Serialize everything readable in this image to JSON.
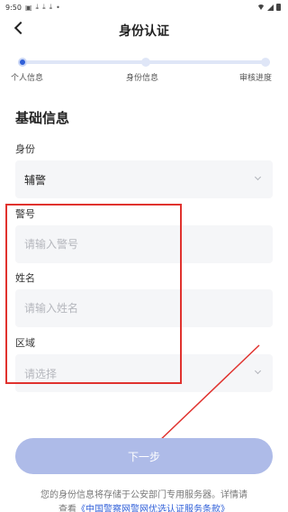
{
  "status_bar": {
    "time": "9:50",
    "icons": [
      "image-icon",
      "download-icon",
      "download-icon",
      "download-icon",
      "dot-icon"
    ],
    "right_icons": [
      "wifi-icon",
      "signal-icon",
      "battery-icon"
    ]
  },
  "nav": {
    "title": "身份认证",
    "back_icon": "chevron-left-icon"
  },
  "progress": {
    "steps": [
      {
        "label": "个人信息",
        "active": true
      },
      {
        "label": "身份信息",
        "active": false
      },
      {
        "label": "审核进度",
        "active": false
      }
    ],
    "colors": {
      "active": "#2f5fd8",
      "inactive": "#dfe6f7"
    }
  },
  "section_title": "基础信息",
  "form": {
    "identity": {
      "label": "身份",
      "value": "辅警"
    },
    "badge_number": {
      "label": "警号",
      "placeholder": "请输入警号"
    },
    "name": {
      "label": "姓名",
      "placeholder": "请输入姓名"
    },
    "region": {
      "label": "区域",
      "placeholder": "请选择"
    }
  },
  "next_button": {
    "label": "下一步",
    "color": "#aebbe8"
  },
  "footer": {
    "line1": "您的身份信息将存储于公安部门专用服务器。详情请",
    "line2_prefix": "查看",
    "line2_link": "《中国警察网警网优选认证服务条款》"
  },
  "annotation": {
    "box_color": "#e0322e"
  }
}
